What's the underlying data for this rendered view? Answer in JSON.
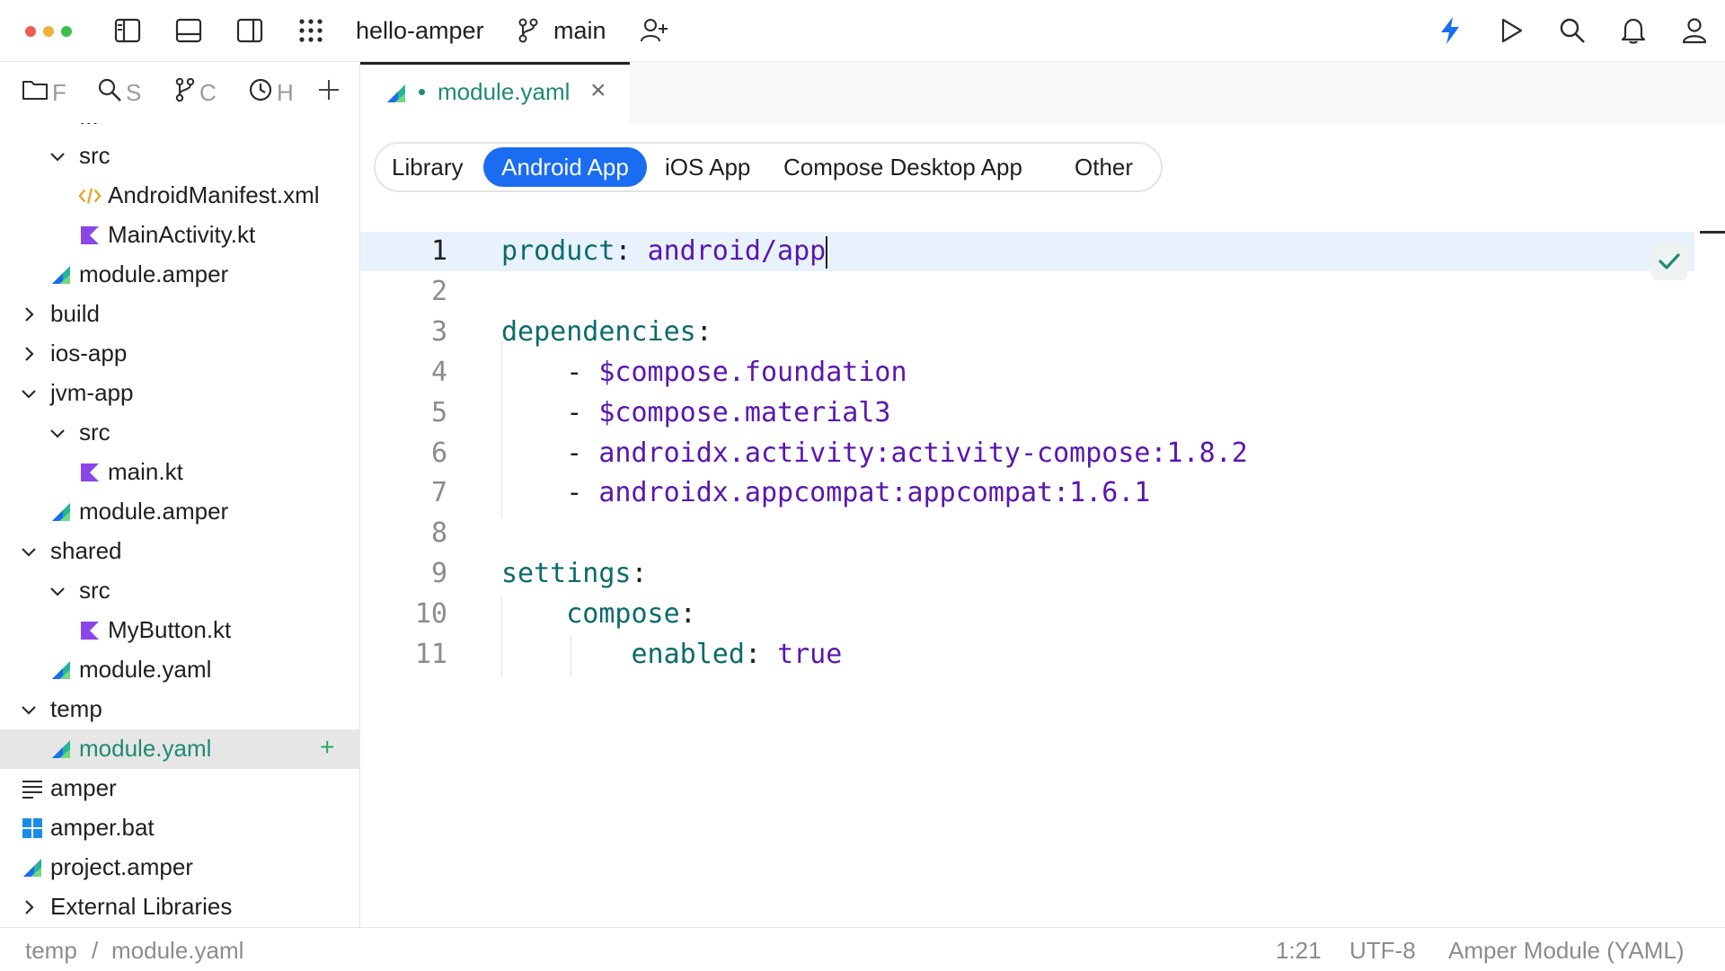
{
  "titlebar": {
    "project_name": "hello-amper",
    "branch": "main",
    "accent_color": "#1a6cf0"
  },
  "toolstrip": {
    "items": [
      {
        "icon": "folder-icon",
        "label": "F"
      },
      {
        "icon": "search-icon",
        "label": "S"
      },
      {
        "icon": "git-branch-icon",
        "label": "C"
      },
      {
        "icon": "clock-icon",
        "label": "H"
      },
      {
        "icon": "plus-icon",
        "label": ""
      }
    ]
  },
  "tree": {
    "partial_top": "...",
    "items": [
      {
        "label": "src",
        "type": "folder",
        "expanded": true
      },
      {
        "label": "AndroidManifest.xml",
        "type": "xml-file"
      },
      {
        "label": "MainActivity.kt",
        "type": "kotlin-file"
      },
      {
        "label": "module.amper",
        "type": "amper-file"
      },
      {
        "label": "build",
        "type": "folder",
        "expanded": false
      },
      {
        "label": "ios-app",
        "type": "folder",
        "expanded": false
      },
      {
        "label": "jvm-app",
        "type": "folder",
        "expanded": true
      },
      {
        "label": "src",
        "type": "folder",
        "expanded": true
      },
      {
        "label": "main.kt",
        "type": "kotlin-file"
      },
      {
        "label": "module.amper",
        "type": "amper-file"
      },
      {
        "label": "shared",
        "type": "folder",
        "expanded": true
      },
      {
        "label": "src",
        "type": "folder",
        "expanded": true
      },
      {
        "label": "MyButton.kt",
        "type": "kotlin-file"
      },
      {
        "label": "module.yaml",
        "type": "amper-file"
      },
      {
        "label": "temp",
        "type": "folder",
        "expanded": true
      },
      {
        "label": "module.yaml",
        "type": "amper-file",
        "selected": true,
        "badge": "+"
      },
      {
        "label": "amper",
        "type": "text-file"
      },
      {
        "label": "amper.bat",
        "type": "windows-file"
      },
      {
        "label": "project.amper",
        "type": "amper-file"
      },
      {
        "label": "External Libraries",
        "type": "folder",
        "expanded": false
      }
    ]
  },
  "editor": {
    "tab_label": "module.yaml",
    "tab_modified_dot": "•",
    "tab_close": "×",
    "templates": [
      "Library",
      "Android App",
      "iOS App",
      "Compose Desktop App",
      "Other"
    ],
    "active_template": "Android App",
    "lines": [
      {
        "n": "1",
        "key": "product",
        "sep": ": ",
        "val": "android/app"
      },
      {
        "n": "2"
      },
      {
        "n": "3",
        "key": "dependencies",
        "sep": ":"
      },
      {
        "n": "4",
        "indent": "    ",
        "dash": "- ",
        "val": "$compose.foundation"
      },
      {
        "n": "5",
        "indent": "    ",
        "dash": "- ",
        "val": "$compose.material3"
      },
      {
        "n": "6",
        "indent": "    ",
        "dash": "- ",
        "val": "androidx.activity:activity-compose:1.8.2"
      },
      {
        "n": "7",
        "indent": "    ",
        "dash": "- ",
        "val": "androidx.appcompat:appcompat:1.6.1"
      },
      {
        "n": "8"
      },
      {
        "n": "9",
        "key": "settings",
        "sep": ":"
      },
      {
        "n": "10",
        "indent": "    ",
        "key": "compose",
        "sep": ":"
      },
      {
        "n": "11",
        "indent": "        ",
        "key": "enabled",
        "sep": ": ",
        "val": "true"
      }
    ]
  },
  "statusbar": {
    "breadcrumb": [
      "temp",
      "module.yaml"
    ],
    "breadcrumb_sep": "/",
    "position": "1:21",
    "encoding": "UTF-8",
    "file_type": "Amper Module (YAML)"
  }
}
